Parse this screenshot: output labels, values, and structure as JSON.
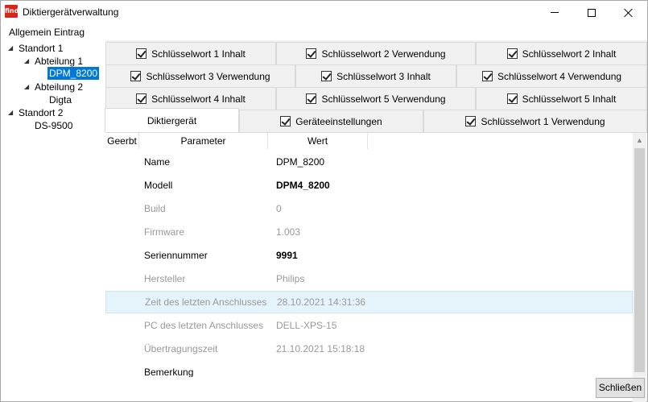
{
  "window": {
    "app_icon_text": "find",
    "title": "Diktiergerätverwaltung"
  },
  "menu": {
    "items": [
      "Allgemein",
      "Eintrag"
    ]
  },
  "tree": {
    "nodes": [
      {
        "label": "Standort 1",
        "expanded": true
      },
      {
        "label": "Abteilung 1",
        "expanded": true
      },
      {
        "label": "DPM_8200",
        "selected": true
      },
      {
        "label": "Abteilung 2",
        "expanded": true
      },
      {
        "label": "Digta"
      },
      {
        "label": "Standort 2",
        "expanded": true
      },
      {
        "label": "DS-9500"
      }
    ]
  },
  "tabs": {
    "row1": [
      "Schlüsselwort 1 Inhalt",
      "Schlüsselwort 2 Verwendung",
      "Schlüsselwort 2 Inhalt"
    ],
    "row2": [
      "Schlüsselwort 3 Verwendung",
      "Schlüsselwort 3 Inhalt",
      "Schlüsselwort 4 Verwendung"
    ],
    "row3": [
      "Schlüsselwort 4 Inhalt",
      "Schlüsselwort 5 Verwendung",
      "Schlüsselwort 5 Inhalt"
    ],
    "row4": [
      "Diktiergerät",
      "Geräteeinstellungen",
      "Schlüsselwort 1 Verwendung"
    ],
    "active": "Diktiergerät"
  },
  "grid": {
    "headers": [
      "Geerbt",
      "Parameter",
      "Wert"
    ],
    "rows": [
      {
        "param": "Name",
        "value": "DPM_8200",
        "style": "normal"
      },
      {
        "param": "Modell",
        "value": "DPM4_8200",
        "style": "bold"
      },
      {
        "param": "Build",
        "value": "0",
        "style": "dim"
      },
      {
        "param": "Firmware",
        "value": "1.003",
        "style": "dim"
      },
      {
        "param": "Seriennummer",
        "value": "9991",
        "style": "bold"
      },
      {
        "param": "Hersteller",
        "value": "Philips",
        "style": "dim"
      },
      {
        "param": "Zeit des letzten Anschlusses",
        "value": "28.10.2021 14:31:36",
        "style": "dim-highlight"
      },
      {
        "param": "PC des letzten Anschlusses",
        "value": "DELL-XPS-15",
        "style": "dim"
      },
      {
        "param": "Übertragungszeit",
        "value": "21.10.2021 15:18:18",
        "style": "dim"
      },
      {
        "param": "Bemerkung",
        "value": "",
        "style": "normal"
      }
    ]
  },
  "buttons": {
    "close_label": "Schließen"
  },
  "colors": {
    "selection": "#0078d7",
    "row_highlight": "#e5f3fb",
    "app_icon": "#d9261c"
  }
}
